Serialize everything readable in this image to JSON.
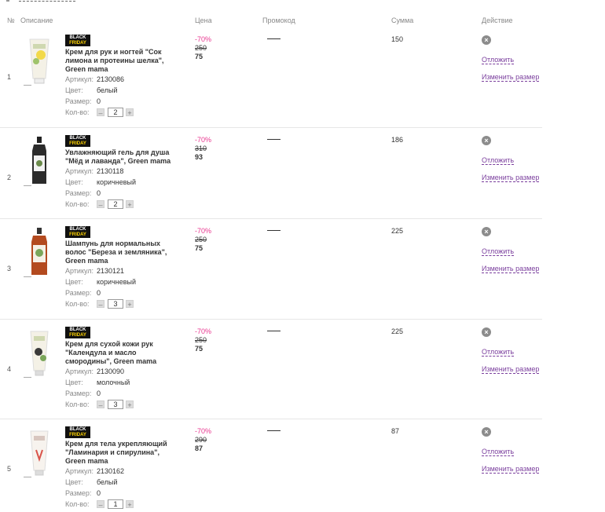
{
  "table": {
    "headers": {
      "num": "№",
      "desc": "Описание",
      "price": "Цена",
      "promo": "Промокод",
      "sum": "Сумма",
      "action": "Действие"
    },
    "labels": {
      "article": "Артикул:",
      "color": "Цвет:",
      "size": "Размер:",
      "qty": "Кол-во:",
      "badge_top": "BLACK",
      "badge_bottom": "FRIDAY",
      "postpone": "Отложить",
      "change_size": "Изменить размер",
      "minus": "–",
      "plus": "+",
      "remove": "×"
    },
    "rows": [
      {
        "num": "1",
        "name": "Крем для рук и ногтей \"Сок лимона и протеины шелка\", Green mama",
        "article": "2130086",
        "color": "белый",
        "size": "0",
        "qty": "2",
        "discount": "-70%",
        "old_price": "250",
        "new_price": "75",
        "sum": "150"
      },
      {
        "num": "2",
        "name": "Увлажняющий гель для душа \"Мёд и лаванда\", Green mama",
        "article": "2130118",
        "color": "коричневый",
        "size": "0",
        "qty": "2",
        "discount": "-70%",
        "old_price": "310",
        "new_price": "93",
        "sum": "186"
      },
      {
        "num": "3",
        "name": "Шампунь для нормальных волос \"Береза и земляника\", Green mama",
        "article": "2130121",
        "color": "коричневый",
        "size": "0",
        "qty": "3",
        "discount": "-70%",
        "old_price": "250",
        "new_price": "75",
        "sum": "225"
      },
      {
        "num": "4",
        "name": "Крем для сухой кожи рук \"Календула и масло смородины\", Green mama",
        "article": "2130090",
        "color": "молочный",
        "size": "0",
        "qty": "3",
        "discount": "-70%",
        "old_price": "250",
        "new_price": "75",
        "sum": "225"
      },
      {
        "num": "5",
        "name": "Крем для тела укрепляющий \"Ламинария и спирулина\", Green mama",
        "article": "2130162",
        "color": "белый",
        "size": "0",
        "qty": "1",
        "discount": "-70%",
        "old_price": "290",
        "new_price": "87",
        "sum": "87"
      }
    ]
  },
  "colors": {
    "accent_link": "#7a3e9d",
    "discount": "#e8368f",
    "badge_bg": "#111111",
    "badge_text_accent": "#ffd400"
  },
  "icons": {
    "remove": "close-circle-icon",
    "product": "product-thumbnail"
  }
}
